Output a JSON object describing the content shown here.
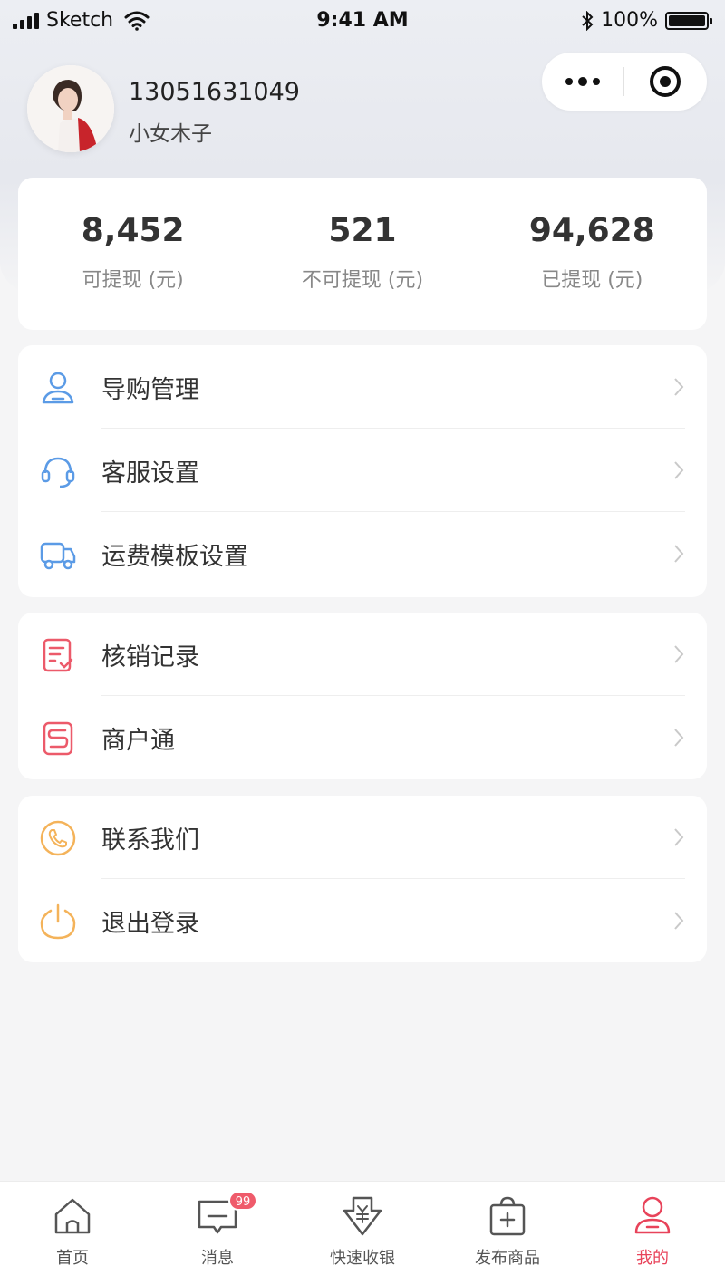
{
  "status_bar": {
    "carrier": "Sketch",
    "time": "9:41 AM",
    "battery": "100%"
  },
  "profile": {
    "phone": "13051631049",
    "nickname": "小女木子"
  },
  "stats": [
    {
      "value": "8,452",
      "label": "可提现 (元)"
    },
    {
      "value": "521",
      "label": "不可提现 (元)"
    },
    {
      "value": "94,628",
      "label": "已提现 (元)"
    }
  ],
  "menu": {
    "group1": [
      {
        "label": "导购管理",
        "icon": "user-icon",
        "color": "#5b9be6"
      },
      {
        "label": "客服设置",
        "icon": "headset-icon",
        "color": "#5b9be6"
      },
      {
        "label": "运费模板设置",
        "icon": "truck-icon",
        "color": "#5b9be6"
      }
    ],
    "group2": [
      {
        "label": "核销记录",
        "icon": "receipt-icon",
        "color": "#ec5a6a"
      },
      {
        "label": "商户通",
        "icon": "merchant-icon",
        "color": "#ec5a6a"
      }
    ],
    "group3": [
      {
        "label": "联系我们",
        "icon": "phone-icon",
        "color": "#f4b35a"
      },
      {
        "label": "退出登录",
        "icon": "power-icon",
        "color": "#f4b35a"
      }
    ]
  },
  "tabbar": {
    "items": [
      {
        "label": "首页",
        "icon": "home-icon"
      },
      {
        "label": "消息",
        "icon": "message-icon",
        "badge": "99"
      },
      {
        "label": "快速收银",
        "icon": "cashier-icon"
      },
      {
        "label": "发布商品",
        "icon": "publish-icon"
      },
      {
        "label": "我的",
        "icon": "profile-icon",
        "active": true
      }
    ],
    "active_color": "#e8435a"
  }
}
